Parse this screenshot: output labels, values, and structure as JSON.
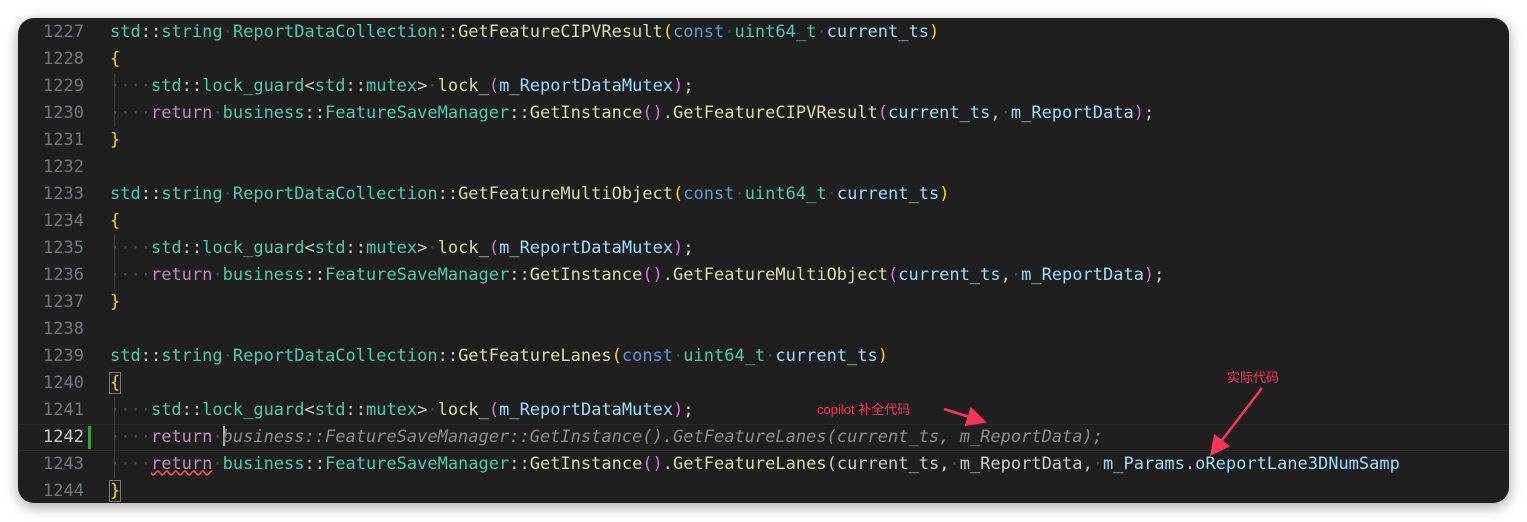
{
  "editor": {
    "line_numbers": [
      "1227",
      "1228",
      "1229",
      "1230",
      "1231",
      "1232",
      "1233",
      "1234",
      "1235",
      "1236",
      "1237",
      "1238",
      "1239",
      "1240",
      "1241",
      "1242",
      "1243",
      "1244"
    ],
    "active_line": "1242",
    "tokens": {
      "std": "std",
      "sep": "::",
      "string": "string",
      "class_name": "ReportDataCollection",
      "fn_cipv": "GetFeatureCIPVResult",
      "fn_multi": "GetFeatureMultiObject",
      "fn_lanes": "GetFeatureLanes",
      "const": "const",
      "uint64": "uint64_t",
      "current_ts": "current_ts",
      "open_paren": "(",
      "close_paren": ")",
      "open_brace": "{",
      "close_brace": "}",
      "lock_guard": "lock_guard",
      "lt": "<",
      "gt": ">",
      "mutex": "mutex",
      "lock": "lock_",
      "report_mutex": "m_ReportDataMutex",
      "close_stmt": ");",
      "return": "return",
      "business": "business",
      "manager": "FeatureSaveManager",
      "get_instance": "GetInstance",
      "call_parens": "()",
      "dot": ".",
      "comma": ",",
      "report_data": "m_ReportData",
      "params": "m_Params",
      "lane_num": "oReportLane3DNumSamp"
    }
  },
  "annotations": {
    "copilot_label": "copilot 补全代码",
    "actual_label": "实际代码",
    "color": "#ff3355"
  },
  "theme": {
    "background": "#1f1f1f",
    "keyword": "#569cd6",
    "type": "#4ec9b0",
    "function": "#dcdcaa",
    "variable": "#9cdcfe",
    "control": "#c586c0",
    "bracket_level1": "#ffd700",
    "bracket_level2": "#da70d6",
    "ghost_text": "#8b8b8b",
    "modified_marker": "#2ea043"
  }
}
